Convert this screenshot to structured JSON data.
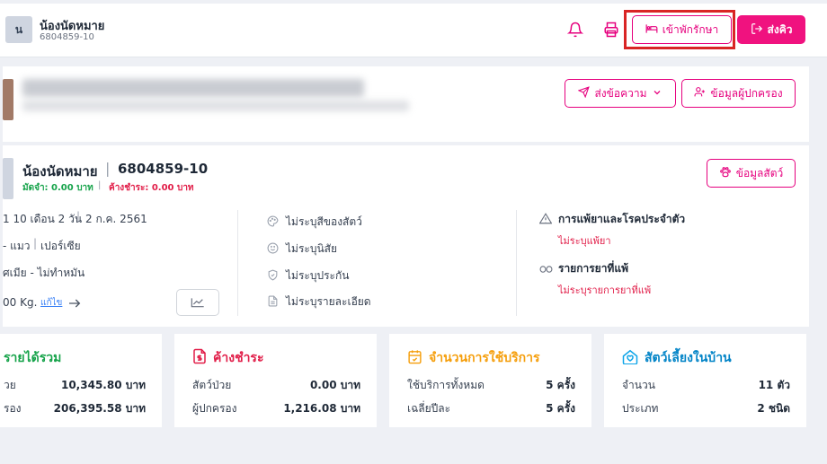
{
  "header": {
    "avatar_letter": "น",
    "pet_name": "น้องนัดหมาย",
    "pet_code": "6804859-10",
    "admit_label": "เข้าพักรักษา",
    "queue_label": "ส่งคิว",
    "icons": [
      "bell-icon",
      "printer-icon",
      "bed-icon",
      "send-icon"
    ]
  },
  "owner": {
    "message_label": "ส่งข้อความ",
    "owner_info_label": "ข้อมูลผู้ปกครอง"
  },
  "pet": {
    "name": "น้องนัดหมาย",
    "code": "6804859-10",
    "deposit_label": "มัดจำ: 0.00 บาท",
    "outstanding_label": "ค้างชำระ: 0.00 บาท",
    "info_button": "ข้อมูลสัตว์",
    "age": "1 10 เดือน 2 วัน",
    "birthdate": "2 ก.ค. 2561",
    "species": "- แมว",
    "breed": "เปอร์เซีย",
    "sex": "ศเมีย - ไม่ทำหมัน",
    "weight": "00 Kg.",
    "edit_link": "แก้ไข",
    "color": "ไม่ระบุสีของสัตว์",
    "temperament": "ไม่ระบุนิสัย",
    "insurance": "ไม่ระบุประกัน",
    "details": "ไม่ระบุรายละเอียด",
    "allergy_title": "การแพ้ยาและโรคประจำตัว",
    "allergy_value": "ไม่ระบุแพ้ยา",
    "drug_allergy_title": "รายการยาที่แพ้",
    "drug_allergy_value": "ไม่ระบุรายการยาที่แพ้"
  },
  "stats": {
    "income": {
      "title": "รายได้รวม",
      "row1_label": "วย",
      "row1_value": "10,345.80 บาท",
      "row2_label": "รอง",
      "row2_value": "206,395.58 บาท"
    },
    "outstanding": {
      "title": "ค้างชำระ",
      "row1_label": "สัตว์ป่วย",
      "row1_value": "0.00 บาท",
      "row2_label": "ผู้ปกครอง",
      "row2_value": "1,216.08 บาท"
    },
    "usage": {
      "title": "จำนวนการใช้บริการ",
      "row1_label": "ใช้บริการทั้งหมด",
      "row1_value": "5 ครั้ง",
      "row2_label": "เฉลี่ยปีละ",
      "row2_value": "5 ครั้ง"
    },
    "pets": {
      "title": "สัตว์เลี้ยงในบ้าน",
      "row1_label": "จำนวน",
      "row1_value": "11 ตัว",
      "row2_label": "ประเภท",
      "row2_value": "2 ชนิด"
    }
  },
  "colors": {
    "accent": "#f0127f",
    "green": "#16a34a",
    "red": "#e11d48",
    "orange": "#f59e0b",
    "teal": "#0ea5e9"
  }
}
